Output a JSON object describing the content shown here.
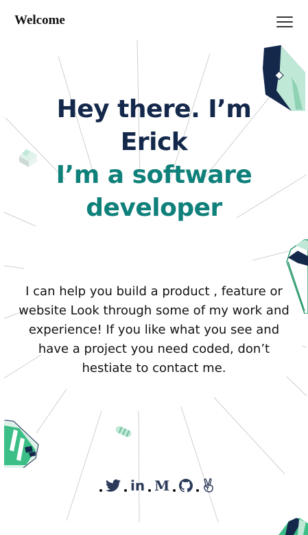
{
  "header": {
    "title": "Welcome",
    "menu_icon": "hamburger-menu-icon"
  },
  "hero": {
    "line1": "Hey there. I’m",
    "line2": "Erick",
    "line3": "I’m a software",
    "line4": "developer"
  },
  "intro": {
    "text": "I can help you build a product , feature or website Look through some of my work and experience! If you like what you see and have a project you need coded, don’t hestiate to contact me."
  },
  "social": {
    "icons": [
      "twitter-icon",
      "linkedin-icon",
      "medium-icon",
      "github-icon",
      "angellist-icon"
    ],
    "linkedin_label": "in",
    "medium_label": "M"
  },
  "colors": {
    "navy": "#14284b",
    "teal": "#0f807a",
    "mint": "#bfe8d6",
    "green": "#3bbf86"
  }
}
